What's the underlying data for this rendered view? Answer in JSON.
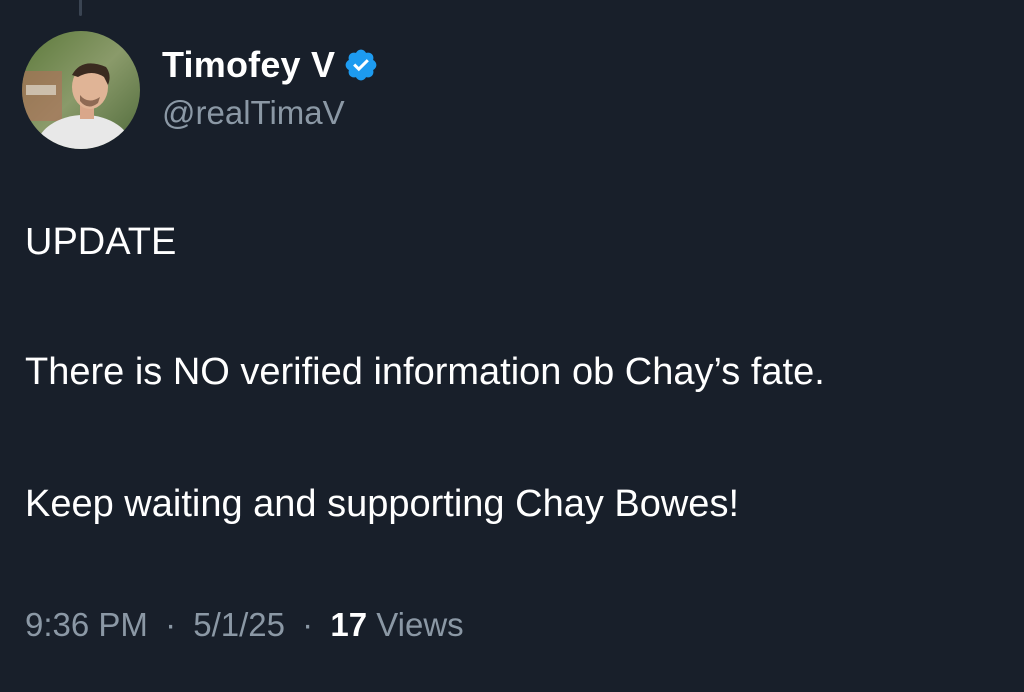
{
  "post": {
    "author": {
      "display_name": "Timofey V",
      "handle": "@realTimaV",
      "verified": true,
      "avatar_icon": "profile-photo",
      "badge_icon": "verified-badge-icon",
      "badge_color": "#1d9bf0"
    },
    "body": {
      "paragraph_1": "UPDATE",
      "paragraph_2": "There is NO verified information ob Chay’s fate.",
      "paragraph_3": "Keep waiting and supporting Chay Bowes!"
    },
    "meta": {
      "time": "9:36 PM",
      "separator": "·",
      "date": "5/1/25",
      "views_count": "17",
      "views_label": "Views"
    }
  },
  "theme": {
    "background": "#181f2a",
    "text_primary": "#ffffff",
    "text_secondary": "#8b98a5"
  }
}
